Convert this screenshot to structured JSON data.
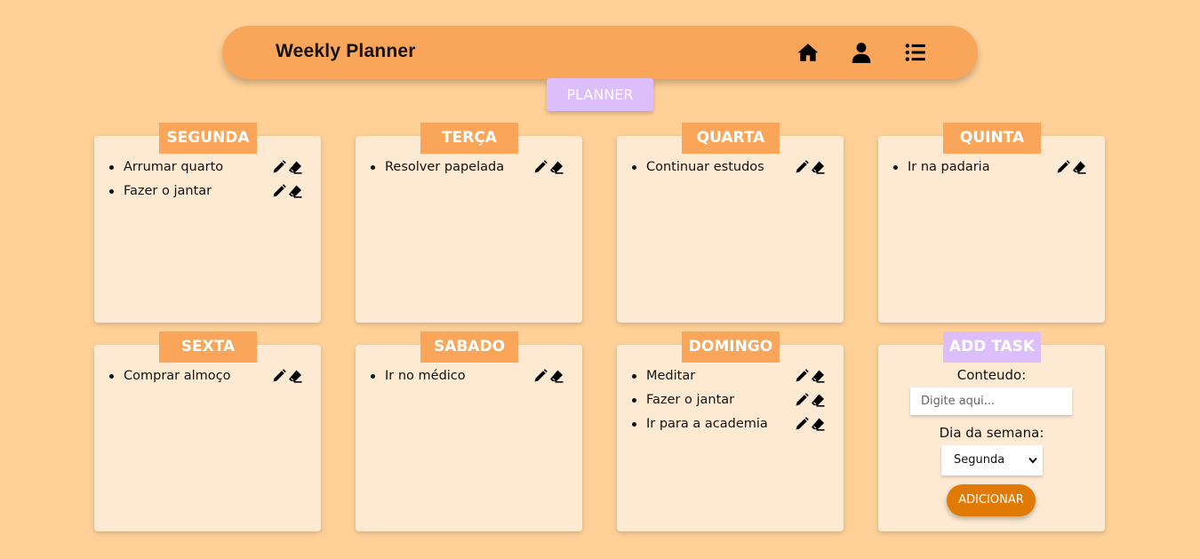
{
  "header": {
    "title": "Weekly Planner",
    "icons": [
      "home-icon",
      "user-icon",
      "list-icon"
    ]
  },
  "planner_tab": "PLANNER",
  "days": [
    {
      "name": "SEGUNDA",
      "tasks": [
        "Arrumar quarto",
        "Fazer o jantar"
      ]
    },
    {
      "name": "TERÇA",
      "tasks": [
        "Resolver papelada"
      ]
    },
    {
      "name": "QUARTA",
      "tasks": [
        "Continuar estudos"
      ]
    },
    {
      "name": "QUINTA",
      "tasks": [
        "Ir na padaria"
      ]
    },
    {
      "name": "SEXTA",
      "tasks": [
        "Comprar almoço"
      ]
    },
    {
      "name": "SABADO",
      "tasks": [
        "Ir no médico"
      ]
    },
    {
      "name": "DOMINGO",
      "tasks": [
        "Meditar",
        "Fazer o jantar",
        "Ir para a academia"
      ]
    }
  ],
  "add_task": {
    "title": "ADD TASK",
    "content_label": "Conteudo:",
    "content_placeholder": "Digite aqui...",
    "day_label": "Dia da semana:",
    "day_selected": "Segunda",
    "submit_label": "ADICIONAR"
  },
  "colors": {
    "background": "#ffd199",
    "accent": "#f9a65a",
    "card": "#feead2",
    "purple": "#dcbefa",
    "button": "#e07a04"
  }
}
